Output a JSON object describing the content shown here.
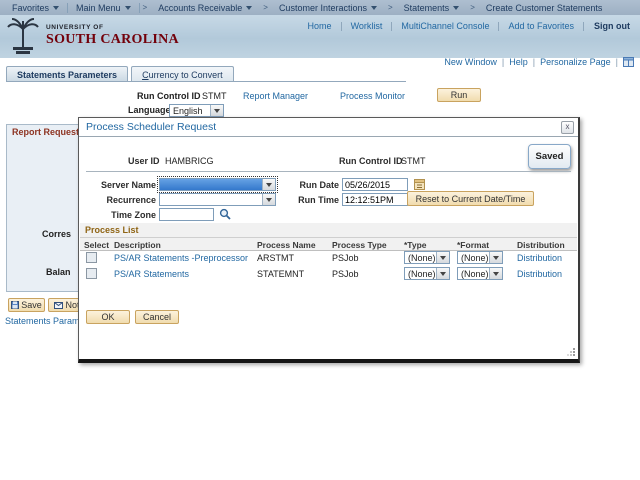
{
  "colors": {
    "garnet": "#73000a",
    "link_blue": "#2268a2",
    "tan_button": "#f1dcae",
    "focus_fill": "#3478cc",
    "section_title_orange": "#8f6414",
    "group_title_maroon": "#8d3321"
  },
  "breadcrumb": {
    "favorites": "Favorites",
    "main_menu": "Main Menu",
    "separator": ">",
    "items": [
      "Accounts Receivable",
      "Customer Interactions",
      "Statements"
    ],
    "current": "Create Customer Statements"
  },
  "header": {
    "logo_line1": "UNIVERSITY OF",
    "logo_line2": "SOUTH CAROLINA",
    "links": [
      "Home",
      "Worklist",
      "MultiChannel Console",
      "Add to Favorites"
    ],
    "sign_out": "Sign out"
  },
  "utility": {
    "links": [
      "New Window",
      "Help",
      "Personalize Page"
    ]
  },
  "tabs": [
    {
      "label": "Statements Parameters"
    },
    {
      "label_first": "C",
      "label_rest": "urrency to Convert"
    }
  ],
  "run_section": {
    "run_control_label": "Run Control ID",
    "run_control_value": "STMT",
    "report_manager": "Report Manager",
    "process_monitor": "Process Monitor",
    "run_button": "Run",
    "language_label": "Language",
    "language_value": "English"
  },
  "report_request": {
    "title": "Report Request",
    "label_correspondence": "Corres",
    "label_balance": "Balan"
  },
  "footer": {
    "save_button": "Save",
    "notify_button": "Noti",
    "link": "Statements Paramet"
  },
  "modal": {
    "title": "Process Scheduler Request",
    "close": "x",
    "saved_button": "Saved",
    "user_id_label": "User ID",
    "user_id_value": "HAMBRICG",
    "run_control_label": "Run Control ID",
    "run_control_value": "STMT",
    "server_name_label": "Server Name",
    "server_name_value": "",
    "recurrence_label": "Recurrence",
    "recurrence_value": "",
    "time_zone_label": "Time Zone",
    "time_zone_value": "",
    "run_date_label": "Run Date",
    "run_date_value": "05/26/2015",
    "run_time_label": "Run Time",
    "run_time_value": "12:12:51PM",
    "reset_button": "Reset to Current Date/Time",
    "process_list": {
      "title": "Process List",
      "columns": [
        "Select",
        "Description",
        "Process Name",
        "Process Type",
        "*Type",
        "*Format",
        "Distribution"
      ],
      "rows": [
        {
          "description": "PS/AR Statements -Preprocessor",
          "process_name": "ARSTMT",
          "process_type": "PSJob",
          "type": "(None)",
          "format": "(None)",
          "distribution": "Distribution"
        },
        {
          "description": "PS/AR Statements",
          "process_name": "STATEMNT",
          "process_type": "PSJob",
          "type": "(None)",
          "format": "(None)",
          "distribution": "Distribution"
        }
      ]
    },
    "ok_button": "OK",
    "cancel_button": "Cancel"
  }
}
